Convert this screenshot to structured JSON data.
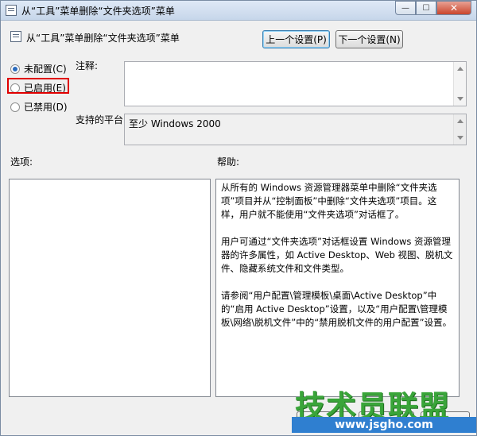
{
  "window": {
    "title": "从“工具”菜单删除“文件夹选项”菜单",
    "controls": {
      "minimize": "—",
      "maximize": "☐",
      "close": "✕"
    }
  },
  "header": {
    "setting_name": "从“工具”菜单删除“文件夹选项”菜单",
    "prev_button": "上一个设置(P)",
    "next_button": "下一个设置(N)"
  },
  "state": {
    "options": [
      {
        "label": "未配置(C)",
        "checked": true
      },
      {
        "label": "已启用(E)",
        "checked": false
      },
      {
        "label": "已禁用(D)",
        "checked": false
      }
    ]
  },
  "comment": {
    "label": "注释:",
    "value": ""
  },
  "platform": {
    "label": "支持的平台:",
    "value": "至少 Windows 2000"
  },
  "options_section": {
    "label": "选项:"
  },
  "help_section": {
    "label": "帮助:",
    "paragraphs": [
      "从所有的 Windows 资源管理器菜单中删除“文件夹选项”项目并从“控制面板”中删除“文件夹选项”项目。这样，用户就不能使用“文件夹选项”对话框了。",
      "用户可通过“文件夹选项”对话框设置 Windows 资源管理器的许多属性，如 Active Desktop、Web 视图、脱机文件、隐藏系统文件和文件类型。",
      "请参阅“用户配置\\管理模板\\桌面\\Active Desktop”中的“启用 Active Desktop”设置，以及“用户配置\\管理模板\\网络\\脱机文件”中的“禁用脱机文件的用户配置”设置。"
    ]
  },
  "watermark": {
    "main": "技术员联盟",
    "sub": "www.jsgho.com"
  },
  "colors": {
    "highlight": "#e00000",
    "radio_dot": "#2a6bbd",
    "watermark_green": "#3aa53a",
    "watermark_blue": "#2f7fd0"
  }
}
